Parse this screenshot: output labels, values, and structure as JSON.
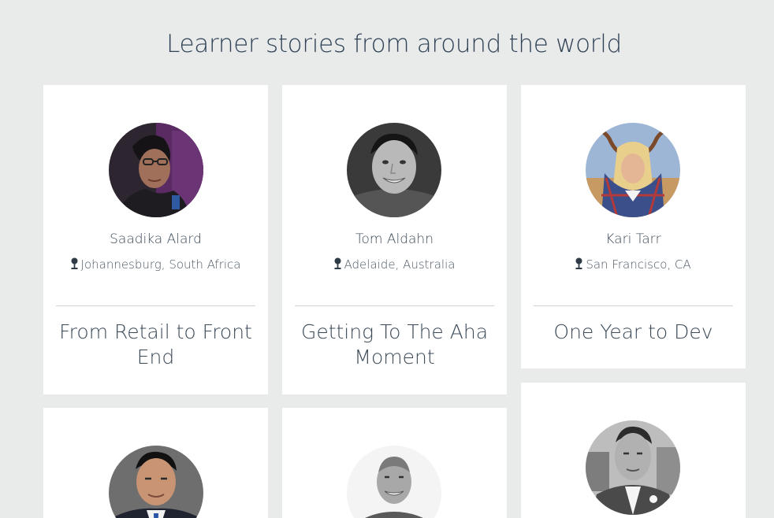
{
  "section": {
    "heading": "Learner stories from around the world"
  },
  "stories": [
    {
      "name": "Saadika Alard",
      "location": "Johannesburg, South Africa",
      "title": "From Retail to Front End"
    },
    {
      "name": "Tom Aldahn",
      "location": "Adelaide, Australia",
      "title": "Getting To The Aha Moment"
    },
    {
      "name": "Kari Tarr",
      "location": "San Francisco, CA",
      "title": "One Year to Dev"
    }
  ],
  "icons": {
    "location": "map-pin-icon"
  }
}
